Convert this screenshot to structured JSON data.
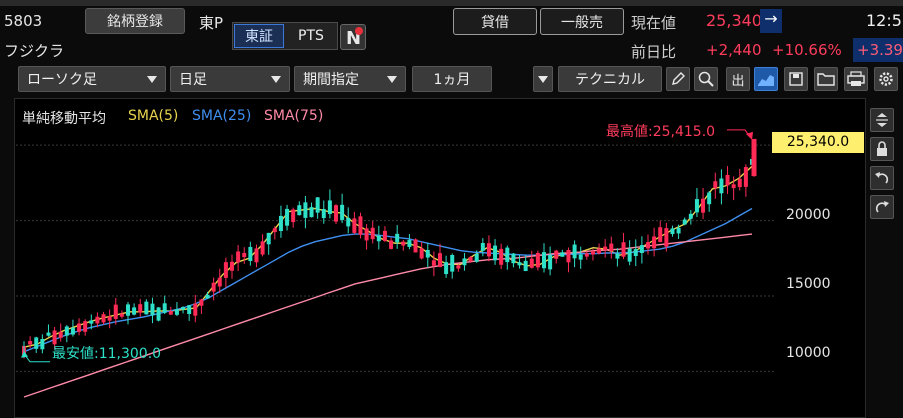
{
  "header": {
    "code": "5803",
    "register_label": "銘柄登録",
    "exchange_label": "東P",
    "market_tabs": [
      "東証",
      "PTS"
    ],
    "name": "フジクラ",
    "lend_label": "貸借",
    "general_sell_label": "一般売",
    "current_price_label": "現在値",
    "current_price": "25,340",
    "arrow": "→",
    "time": "12:5",
    "change_label": "前日比",
    "change": "+2,440",
    "change_pct": "+10.66%",
    "extra_pct": "+3.39"
  },
  "toolbar": {
    "candle_type": "ローソク足",
    "period_type": "日足",
    "range_type": "期間指定",
    "range_value": "1ヵ月",
    "technical_label": "テクニカル",
    "out_label": "出"
  },
  "chart": {
    "indicator_title": "単純移動平均",
    "legend": [
      {
        "label": "SMA(5)",
        "color": "#e8d44d"
      },
      {
        "label": "SMA(25)",
        "color": "#3f8ff0"
      },
      {
        "label": "SMA(75)",
        "color": "#ff8aa8"
      }
    ],
    "max_label": "最高値:25,415.0",
    "min_label": "最安値:11,300.0",
    "price_tag": "25,340.0",
    "y_ticks": [
      "20000",
      "15000",
      "10000"
    ],
    "colors": {
      "up": "#ff2a55",
      "down": "#2ee0c8",
      "tag_bg": "#ffef6e"
    }
  },
  "chart_data": {
    "type": "candlestick",
    "ylim": [
      8100,
      27200
    ],
    "y_ticks": [
      10000,
      15000,
      20000
    ],
    "max": 25415.0,
    "min": 11300.0,
    "last": 25340.0,
    "series": [
      {
        "name": "SMA(5)",
        "values": [
          11600,
          11800,
          12300,
          12700,
          13000,
          13300,
          13550,
          13750,
          13950,
          13950,
          14000,
          14000,
          14100,
          14200,
          15300,
          16400,
          17200,
          17500,
          18400,
          19500,
          20600,
          20700,
          20800,
          20600,
          20500,
          19800,
          19300,
          18800,
          18500,
          18500,
          18200,
          17500,
          17100,
          17100,
          17700,
          18200,
          17900,
          17300,
          17000,
          17100,
          17600,
          17800,
          17900,
          18200,
          18100,
          17700,
          17900,
          18400,
          18900,
          19400,
          19800,
          20900,
          22100,
          22300,
          22800,
          23600
        ]
      },
      {
        "name": "SMA(25)",
        "values": [
          11300,
          11650,
          12000,
          12350,
          12650,
          12900,
          13100,
          13300,
          13450,
          13600,
          13800,
          14000,
          14200,
          14500,
          14900,
          15400,
          15900,
          16400,
          16900,
          17400,
          17900,
          18300,
          18600,
          18800,
          19000,
          19100,
          19100,
          19000,
          18900,
          18800,
          18600,
          18400,
          18200,
          18000,
          17900,
          17850,
          17800,
          17750,
          17700,
          17700,
          17750,
          17750,
          17800,
          17800,
          17850,
          17850,
          17900,
          18000,
          18100,
          18300,
          18600,
          19000,
          19400,
          19800,
          20300,
          20800
        ]
      },
      {
        "name": "SMA(75)",
        "values": [
          8300,
          8600,
          8900,
          9200,
          9500,
          9800,
          10100,
          10400,
          10700,
          11000,
          11300,
          11600,
          11900,
          12200,
          12500,
          12800,
          13100,
          13400,
          13700,
          14000,
          14300,
          14600,
          14900,
          15200,
          15500,
          15800,
          16000,
          16200,
          16400,
          16600,
          16800,
          16950,
          17100,
          17200,
          17300,
          17400,
          17450,
          17500,
          17600,
          17700,
          17800,
          17850,
          17900,
          18000,
          18050,
          18100,
          18200,
          18300,
          18400,
          18500,
          18600,
          18700,
          18800,
          18900,
          19000,
          19100
        ]
      }
    ]
  }
}
